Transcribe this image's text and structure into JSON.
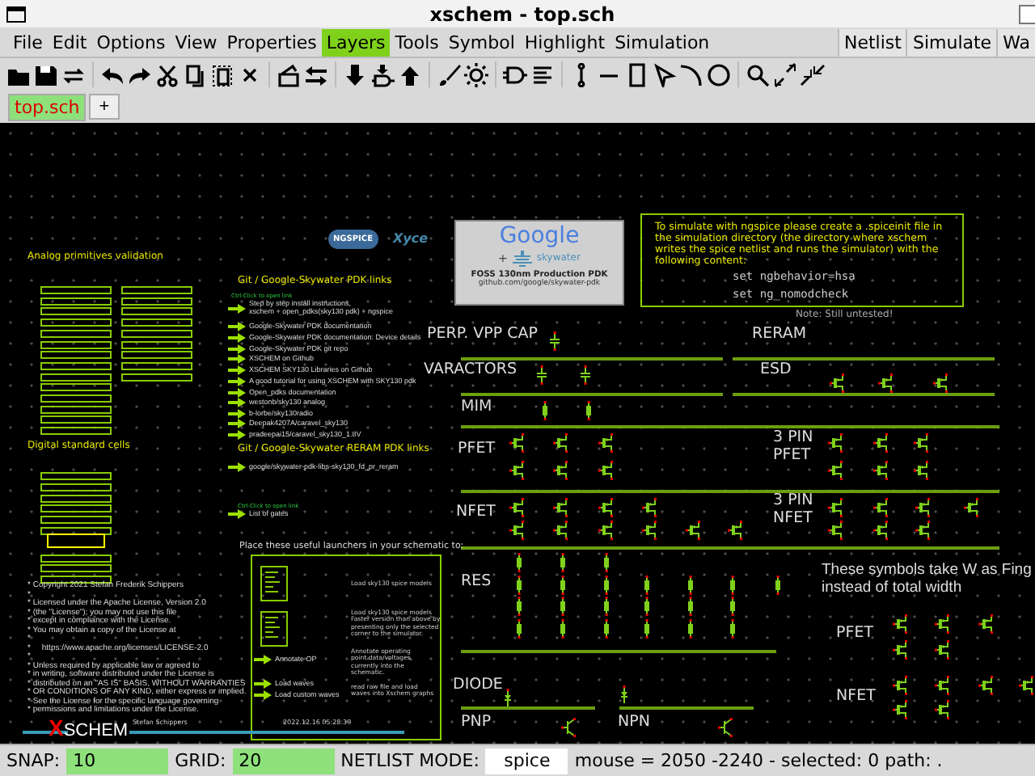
{
  "window": {
    "title": "xschem - top.sch"
  },
  "menu": {
    "items": [
      {
        "label": "File",
        "selected": false
      },
      {
        "label": "Edit",
        "selected": false
      },
      {
        "label": "Options",
        "selected": false
      },
      {
        "label": "View",
        "selected": false
      },
      {
        "label": "Properties",
        "selected": false
      },
      {
        "label": "Layers",
        "selected": true
      },
      {
        "label": "Tools",
        "selected": false
      },
      {
        "label": "Symbol",
        "selected": false
      },
      {
        "label": "Highlight",
        "selected": false
      },
      {
        "label": "Simulation",
        "selected": false
      }
    ],
    "actions": [
      "Netlist",
      "Simulate",
      "Wa"
    ]
  },
  "tabs": [
    {
      "label": "top.sch",
      "selected": true
    }
  ],
  "new_tab_button": "+",
  "schematic": {
    "analog_validation": {
      "title": "Analog primitives validation"
    },
    "digital_cells": {
      "title": "Digital standard cells"
    },
    "simulator_logos": [
      "NGSPICE",
      "Xyce"
    ],
    "pdk_links": {
      "title": "Git / Google-Skywater PDK links",
      "hint": "Ctrl-Click to open link",
      "links": [
        "Step by step install instructions,\nxschem + open_pdks(sky130 pdk) + ngspice",
        "Google-Skywater PDK documentation",
        "Google-Skywater PDK documentation: Device details",
        "Google-Skywater PDK git repo",
        "XSCHEM on Github",
        "XSCHEM SKY130 Libraries on Github",
        "A good tutorial for using XSCHEM with SKY130 pdk",
        "Open_pdks documentation",
        "westonb/sky130 analog",
        "b-lorbe/sky130radio",
        "Deepak4207A/caravel_sky130",
        "pradeepai15/caravel_sky130_1.8V"
      ]
    },
    "reram_links": {
      "title": "Git / Google-Skywater RERAM PDK links",
      "links": [
        "google/skywater-pdk-libs-sky130_fd_pr_reram"
      ]
    },
    "gates_links": {
      "hint": "Ctrl-Click to open link",
      "links": [
        "List of gates"
      ]
    },
    "pdk_card": {
      "brand": "Google",
      "plus": "+",
      "partner": "skywater",
      "caption": "FOSS 130nm Production PDK",
      "url": "github.com/google/skywater-pdk"
    },
    "spiceinit_note": {
      "text": "To simulate with ngspice please create a .spiceinit file in the simulation directory (the directory where xschem writes the spice netlist and runs the simulator) with the following content:",
      "code": [
        "set ngbehavior=hsa",
        "set ng_nomodcheck"
      ],
      "note": "Note: Still untested!"
    },
    "device_labels": [
      "PERP. VPP CAP",
      "RERAM",
      "VARACTORS",
      "ESD",
      "MIM",
      "PFET",
      "3 PIN\nPFET",
      "NFET",
      "3 PIN\nNFET",
      "RES",
      "DIODE",
      "PNP",
      "NPN",
      "PFET",
      "NFET"
    ],
    "finger_note": [
      "These symbols take W as Fing",
      "instead of total width"
    ],
    "launchers": {
      "title": "Place these useful launchers in your schematic to:",
      "items": [
        {
          "kind": "document",
          "description": "Load sky130 spice models"
        },
        {
          "kind": "document",
          "description": "Load sky130 spice models\nFaster version than above by\npresenting only the selected\ncorner to the simulator."
        },
        {
          "kind": "arrow",
          "label": "Annotate OP",
          "description": "Annotate operating\npoint data/voltages,\ncurrently into the\nschematic."
        },
        {
          "kind": "arrow",
          "label": "Load waves",
          "description": "read raw file and load\nwaves into Xschem graphs"
        },
        {
          "kind": "arrow",
          "label": "Load custom waves"
        }
      ]
    },
    "license": [
      "* Copyright 2021 Stefan Frederik Schippers",
      "*",
      "* Licensed under the Apache License, Version 2.0",
      "* (the \"License\"); you may not use this file",
      "* except in compliance with the License.",
      "* You may obtain a copy of the License at",
      "*",
      "*     https://www.apache.org/licenses/LICENSE-2.0",
      "*",
      "* Unless required by applicable law or agreed to",
      "* in writing, software distributed under the License is",
      "* distributed on an \"AS IS\" BASIS, WITHOUT WARRANTIES",
      "* OR CONDITIONS OF ANY KIND, either express or implied.",
      "* See the License for the specific language governing",
      "* permissions and limitations under the License."
    ],
    "logo": "XSCHEM",
    "author": "Stefan Schippers",
    "timestamp": "2022.12.16 05:28:39"
  },
  "status_bar": {
    "snap_label": "SNAP:",
    "snap": "10",
    "grid_label": "GRID:",
    "grid": "20",
    "netlist_mode_label": "NETLIST MODE:",
    "netlist_mode": "spice",
    "info": "mouse = 2050 -2240 - selected: 0 path: ."
  }
}
